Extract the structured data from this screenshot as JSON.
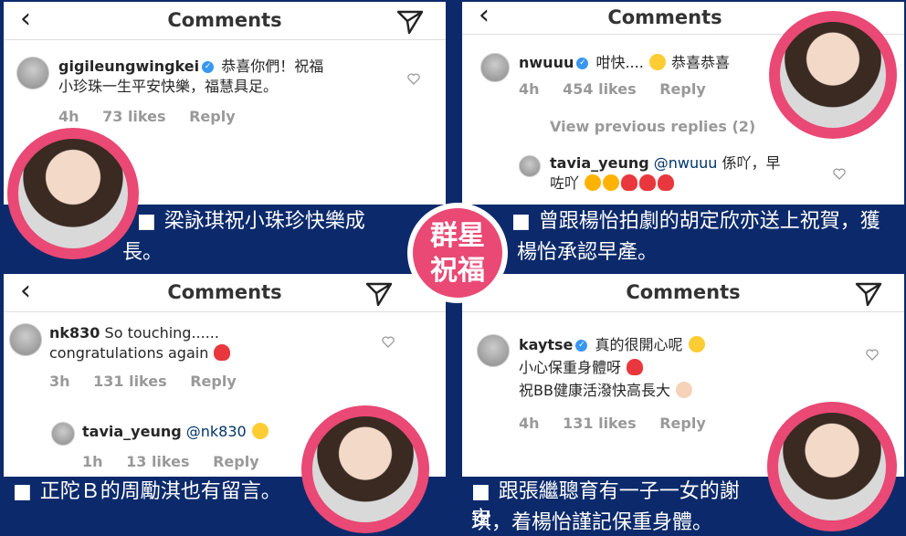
{
  "center_badge": {
    "line1": "群星",
    "line2": "祝福"
  },
  "panels": [
    {
      "nav_title": "Comments",
      "comment": {
        "username": "gigileungwingkei",
        "text_line1": "恭喜你們！祝福",
        "text_line2": "小珍珠一生平安快樂，福慧具足。"
      },
      "meta": {
        "time": "4h",
        "likes": "73 likes",
        "reply": "Reply"
      },
      "caption": {
        "line1": "梁詠琪祝小珠珍快樂成",
        "line2": "長。"
      }
    },
    {
      "nav_title": "Comments",
      "comment": {
        "username": "nwuuu",
        "text": "咁快....",
        "text_after": "恭喜恭喜"
      },
      "meta": {
        "time": "4h",
        "likes": "454 likes",
        "reply": "Reply"
      },
      "view_previous": "View previous replies (2)",
      "reply_comment": {
        "username": "tavia_yeung",
        "mention": "@nwuuu",
        "text_line1": "係吖，早",
        "text_line2": "咗吖"
      },
      "caption": {
        "line1": "曾跟楊怡拍劇的胡定欣亦送上祝賀，獲",
        "line2": "楊怡承認早產。"
      }
    },
    {
      "nav_title": "Comments",
      "comment": {
        "username": "nk830",
        "text_line1": "So touching......",
        "text_line2": "congratulations again"
      },
      "meta": {
        "time": "3h",
        "likes": "131 likes",
        "reply": "Reply"
      },
      "reply_comment": {
        "username": "tavia_yeung",
        "mention": "@nk830"
      },
      "reply_meta": {
        "time": "1h",
        "likes": "13 likes",
        "reply": "Reply"
      },
      "caption": {
        "line1": "正陀Ｂ的周勵淇也有留言。"
      }
    },
    {
      "nav_title": "Comments",
      "comment": {
        "username": "kaytse",
        "text_line1": "真的很開心呢",
        "text_line2": "小心保重身體呀",
        "text_line3": "祝BB健康活潑快高長大"
      },
      "meta": {
        "time": "4h",
        "likes": "131 likes",
        "reply": "Reply"
      },
      "caption": {
        "line1": "跟張繼聰育有一子一女的謝安",
        "line2": "琪，着楊怡謹記保重身體。"
      }
    }
  ],
  "colors": {
    "accent_pink": "#e94974",
    "navy": "#0c2a6b",
    "verified_blue": "#3897f0"
  }
}
